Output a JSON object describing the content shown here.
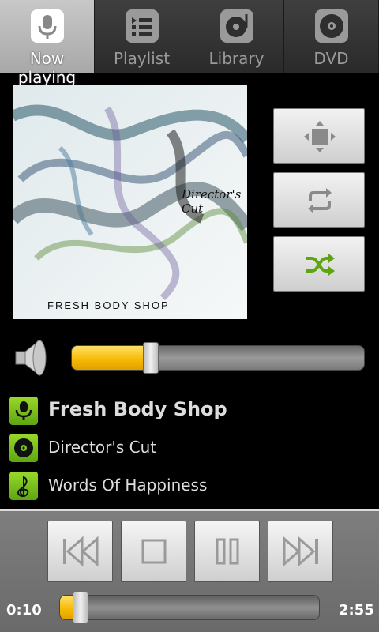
{
  "tabs": [
    {
      "label": "Now playing",
      "icon": "microphone-icon",
      "active": true
    },
    {
      "label": "Playlist",
      "icon": "playlist-icon",
      "active": false
    },
    {
      "label": "Library",
      "icon": "turntable-icon",
      "active": false
    },
    {
      "label": "DVD",
      "icon": "disc-icon",
      "active": false
    }
  ],
  "album_art": {
    "subtitle": "Director's Cut",
    "title": "FRESH BODY SHOP"
  },
  "side_buttons": [
    {
      "icon": "dpad-icon"
    },
    {
      "icon": "repeat-icon"
    },
    {
      "icon": "shuffle-icon",
      "active": true,
      "color": "#5da513"
    }
  ],
  "volume": {
    "level": 0.27
  },
  "track_info": {
    "artist": "Fresh Body Shop",
    "album": "Director's Cut",
    "song": "Words Of Happiness"
  },
  "playback": {
    "elapsed": "0:10",
    "total": "2:55",
    "progress": 0.08
  },
  "colors": {
    "accent": "#f5b800",
    "icon_green": "#7cc21f"
  }
}
